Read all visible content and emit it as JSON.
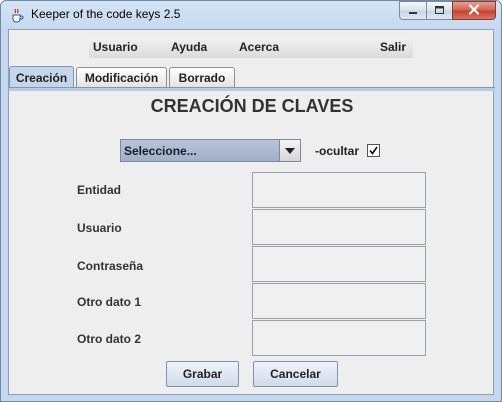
{
  "window": {
    "title": "Keeper of the code keys 2.5"
  },
  "menu": {
    "items": [
      "Usuario",
      "Ayuda",
      "Acerca",
      "Salir"
    ]
  },
  "tabs": [
    {
      "label": "Creación",
      "active": true
    },
    {
      "label": "Modificación",
      "active": false
    },
    {
      "label": "Borrado",
      "active": false
    }
  ],
  "form": {
    "heading": "CREACIÓN DE CLAVES",
    "select": {
      "selected": "Seleccione..."
    },
    "ocultar": {
      "label": "-ocultar",
      "checked": true
    },
    "fields": [
      {
        "label": "Entidad",
        "value": ""
      },
      {
        "label": "Usuario",
        "value": ""
      },
      {
        "label": "Contraseña",
        "value": ""
      },
      {
        "label": "Otro dato 1",
        "value": ""
      },
      {
        "label": "Otro dato 2",
        "value": ""
      }
    ],
    "buttons": {
      "save": "Grabar",
      "cancel": "Cancelar"
    }
  },
  "icons": {
    "app": "java-cup-icon",
    "minimize": "minimize-icon",
    "maximize": "maximize-icon",
    "close": "close-icon",
    "dropdown": "chevron-down-icon",
    "check": "checkmark-icon"
  }
}
